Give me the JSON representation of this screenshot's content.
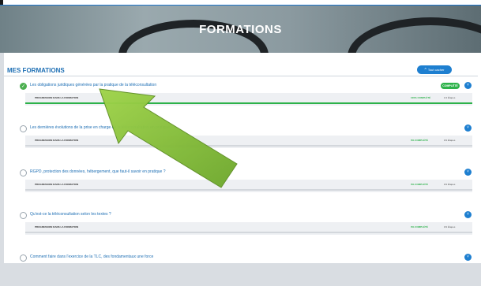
{
  "header": {
    "title": "FORMATIONS"
  },
  "section": {
    "title": "MES FORMATIONS",
    "toggle_all_label": "Tout cacher"
  },
  "trainings": [
    {
      "title": "Les obligations juridiques générées par la pratique de la téléconsultation",
      "completed": true,
      "badge": "COMPLÉTÉ",
      "progress_label": "PROGRESSION DANS LA FORMATION",
      "percent_text": "100% COMPLÉTÉ",
      "steps_text": "1/1 Étapes",
      "progress": 1.0
    },
    {
      "title": "Les dernières évolutions de la prise en charge de la téléconsultation en pratique",
      "completed": false,
      "badge": "",
      "progress_label": "PROGRESSION DANS LA FORMATION",
      "percent_text": "0% COMPLÉTÉ",
      "steps_text": "0/1 Étapes",
      "progress": 0.0
    },
    {
      "title": "RGPD, protection des données, hébergement, que faut-il savoir en pratique ?",
      "completed": false,
      "badge": "",
      "progress_label": "PROGRESSION DANS LA FORMATION",
      "percent_text": "0% COMPLÉTÉ",
      "steps_text": "0/1 Étapes",
      "progress": 0.0
    },
    {
      "title": "Qu'est-ce la téléconsultation selon les textes ?",
      "completed": false,
      "badge": "",
      "progress_label": "PROGRESSION DANS LA FORMATION",
      "percent_text": "0% COMPLÉTÉ",
      "steps_text": "0/1 Étapes",
      "progress": 0.0
    },
    {
      "title": "Comment faire dans l'exercice de la TLC, des fondamentaux une force",
      "completed": false,
      "badge": "",
      "progress_label": "",
      "percent_text": "",
      "steps_text": "",
      "progress": 0.0
    }
  ],
  "colors": {
    "accent": "#1e7fd0",
    "complete": "#2db24a",
    "arrow": "#8cc63f"
  },
  "icons": {
    "check": "check-icon",
    "toggle": "chevron-down-icon",
    "arrow": "annotation-arrow-icon"
  }
}
